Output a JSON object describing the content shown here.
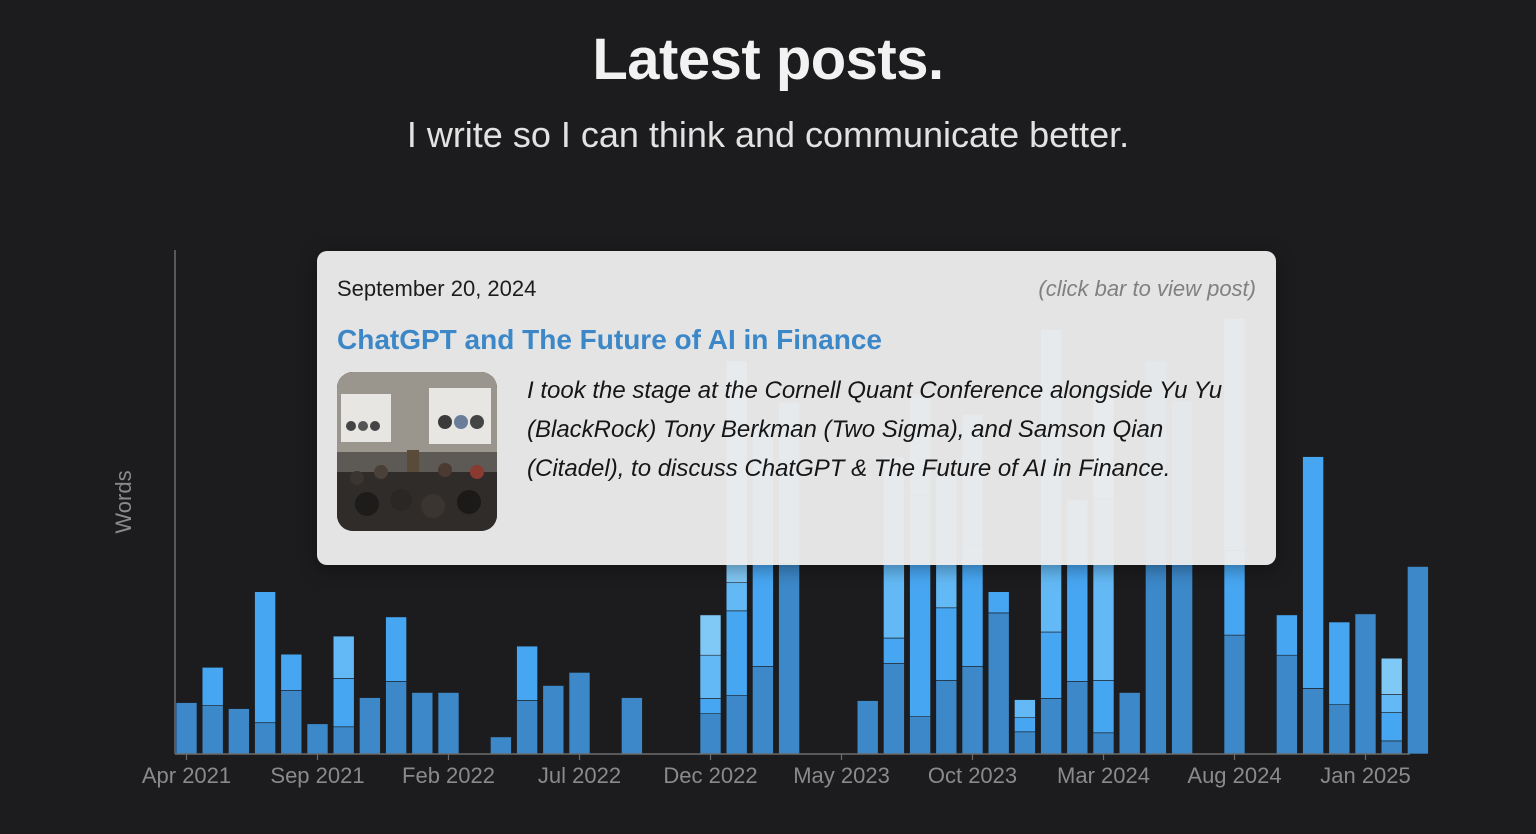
{
  "header": {
    "title": "Latest posts.",
    "subtitle": "I write so I can think and communicate better."
  },
  "chart_data": {
    "type": "bar",
    "stacked": true,
    "ylabel": "Words",
    "xlabel": "",
    "x_ticks": [
      "Apr 2021",
      "Sep 2021",
      "Feb 2022",
      "Jul 2022",
      "Dec 2022",
      "May 2023",
      "Oct 2023",
      "Mar 2024",
      "Aug 2024",
      "Jan 2025"
    ],
    "x_tick_month_index": [
      0,
      5,
      10,
      15,
      20,
      25,
      30,
      35,
      40,
      45
    ],
    "ylim": [
      0,
      5000
    ],
    "grid": false,
    "legend": "none",
    "colors": [
      "#3c88c8",
      "#47a6f2",
      "#63b9f5",
      "#80c8f5"
    ],
    "months": [
      "Apr 2021",
      "May 2021",
      "Jun 2021",
      "Jul 2021",
      "Aug 2021",
      "Sep 2021",
      "Oct 2021",
      "Nov 2021",
      "Dec 2021",
      "Jan 2022",
      "Feb 2022",
      "Mar 2022",
      "Apr 2022",
      "May 2022",
      "Jun 2022",
      "Jul 2022",
      "Aug 2022",
      "Sep 2022",
      "Oct 2022",
      "Nov 2022",
      "Dec 2022",
      "Jan 2023",
      "Feb 2023",
      "Mar 2023",
      "Apr 2023",
      "May 2023",
      "Jun 2023",
      "Jul 2023",
      "Aug 2023",
      "Sep 2023",
      "Oct 2023",
      "Nov 2023",
      "Dec 2023",
      "Jan 2024",
      "Feb 2024",
      "Mar 2024",
      "Apr 2024",
      "May 2024",
      "Jun 2024",
      "Jul 2024",
      "Aug 2024",
      "Sep 2024",
      "Oct 2024",
      "Nov 2024",
      "Dec 2024",
      "Jan 2025"
    ],
    "stacks": [
      [
        510
      ],
      [
        480,
        380
      ],
      [
        450
      ],
      [
        310,
        1300
      ],
      [
        630,
        360
      ],
      [
        300
      ],
      [
        270,
        480,
        420
      ],
      [
        560
      ],
      [
        720,
        640
      ],
      [
        610
      ],
      [
        610
      ],
      [
        0
      ],
      [
        170
      ],
      [
        530,
        540
      ],
      [
        680
      ],
      [
        810
      ],
      [
        0
      ],
      [
        560
      ],
      [
        0
      ],
      [
        0
      ],
      [
        400,
        150,
        430,
        400
      ],
      [
        580,
        840,
        280,
        2200
      ],
      [
        870,
        2400
      ],
      [
        1890,
        1600
      ],
      [
        0
      ],
      [
        0
      ],
      [
        530
      ],
      [
        900,
        250,
        1800
      ],
      [
        370,
        2200,
        1000
      ],
      [
        730,
        720,
        1300
      ],
      [
        870,
        1200,
        1300
      ],
      [
        1400,
        210
      ],
      [
        220,
        140,
        180
      ],
      [
        550,
        660,
        3000
      ],
      [
        720,
        1800
      ],
      [
        210,
        520,
        1800,
        1100
      ],
      [
        610
      ],
      [
        3900
      ],
      [
        3500
      ],
      [
        0
      ],
      [
        1180,
        840,
        2300
      ],
      [
        0
      ],
      [
        980,
        400
      ],
      [
        650,
        2300
      ],
      [
        490,
        820
      ],
      [
        1390
      ],
      [
        130,
        280,
        180,
        360
      ],
      [
        1860
      ]
    ]
  },
  "tooltip": {
    "date": "September 20, 2024",
    "hint": "(click bar to view post)",
    "title": "ChatGPT and The Future of AI in Finance",
    "excerpt": "I took the stage at the Cornell Quant Conference alongside Yu Yu (BlackRock) Tony Berkman (Two Sigma), and Samson Qian (Citadel), to discuss ChatGPT & The Future of AI in Finance.",
    "thumbnail_icon": "conference-panel-photo"
  }
}
